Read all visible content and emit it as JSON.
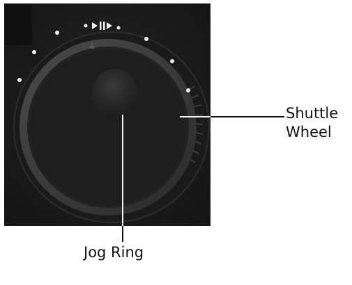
{
  "diagram": {
    "callouts": [
      {
        "id": "shuttle",
        "lines": [
          "Shuttle",
          "Wheel"
        ]
      },
      {
        "id": "jog",
        "lines": [
          "Jog Ring"
        ]
      }
    ]
  },
  "colors": {
    "device_body": "#1b1b1b",
    "device_body_dark": "#121212",
    "bezel_ring": "#303030",
    "jog_ring": "#3c3c3c",
    "center_disc": "#1d1d1d",
    "indicator_dots": "#f2f2f2",
    "callout_lines": "#111111"
  },
  "icons": [
    "shuttle-indicator-dot",
    "play-pause-icon"
  ]
}
